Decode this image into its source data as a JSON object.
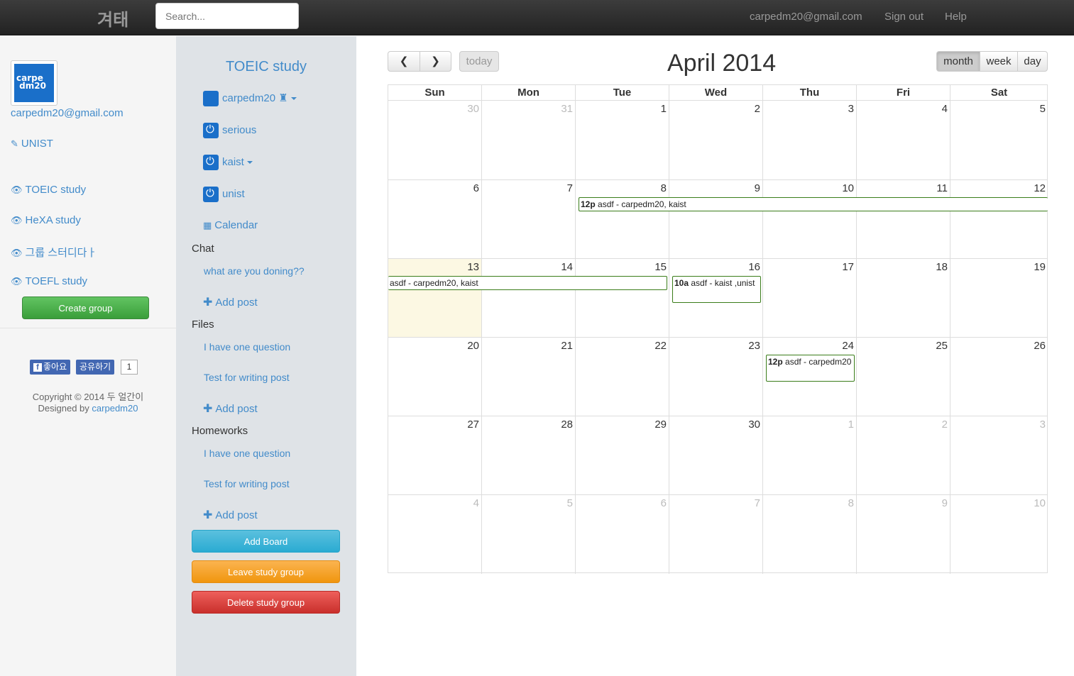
{
  "header": {
    "brand": "겨태",
    "search_placeholder": "Search...",
    "email": "carpedm20@gmail.com",
    "sign_out": "Sign out",
    "help": "Help"
  },
  "left": {
    "avatar_text": "carpe dm20",
    "email": "carpedm20@gmail.com",
    "school": "UNIST",
    "groups": [
      "TOEIC study",
      "HeXA study",
      "그룹 스터디다ㅏ",
      "TOEFL study"
    ],
    "create_group": "Create group",
    "fb_like": "좋아요",
    "fb_share": "공유하기",
    "fb_count": "1",
    "copyright": "Copyright © 2014 두 얼간이",
    "designed_by": "Designed by",
    "designer": "carpedm20"
  },
  "group": {
    "title": "TOEIC study",
    "members": [
      "carpedm20",
      "serious",
      "kaist",
      "unist"
    ],
    "calendar": "Calendar",
    "boards": [
      {
        "name": "Chat",
        "posts": [
          "what are you doning??"
        ],
        "add": "Add post"
      },
      {
        "name": "Files",
        "posts": [
          "I have one question",
          "Test for writing post"
        ],
        "add": "Add post"
      },
      {
        "name": "Homeworks",
        "posts": [
          "I have one question",
          "Test for writing post"
        ],
        "add": "Add post"
      }
    ],
    "add_board": "Add Board",
    "leave": "Leave study group",
    "delete": "Delete study group"
  },
  "calendar": {
    "title": "April 2014",
    "today": "today",
    "views": [
      "month",
      "week",
      "day"
    ],
    "active_view": "month",
    "weekdays": [
      "Sun",
      "Mon",
      "Tue",
      "Wed",
      "Thu",
      "Fri",
      "Sat"
    ],
    "weeks": [
      [
        "30",
        "31",
        "1",
        "2",
        "3",
        "4",
        "5"
      ],
      [
        "6",
        "7",
        "8",
        "9",
        "10",
        "11",
        "12"
      ],
      [
        "13",
        "14",
        "15",
        "16",
        "17",
        "18",
        "19"
      ],
      [
        "20",
        "21",
        "22",
        "23",
        "24",
        "25",
        "26"
      ],
      [
        "27",
        "28",
        "29",
        "30",
        "1",
        "2",
        "3"
      ],
      [
        "4",
        "5",
        "6",
        "7",
        "8",
        "9",
        "10"
      ]
    ],
    "today_date": "13",
    "events": [
      {
        "time": "12p",
        "text": "asdf - carpedm20, kaist"
      },
      {
        "time": "",
        "text": "asdf - carpedm20, kaist"
      },
      {
        "time": "10a",
        "text": "asdf - kaist ,unist"
      },
      {
        "time": "12p",
        "text": "asdf - carpedm20"
      }
    ]
  }
}
